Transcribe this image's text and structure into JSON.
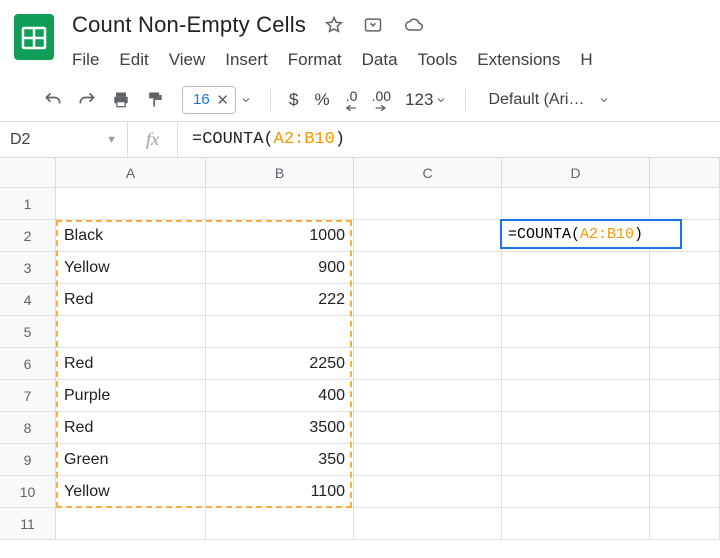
{
  "doc": {
    "title": "Count Non-Empty Cells"
  },
  "menu": {
    "file": "File",
    "edit": "Edit",
    "view": "View",
    "insert": "Insert",
    "format": "Format",
    "data": "Data",
    "tools": "Tools",
    "extensions": "Extensions",
    "help": "H"
  },
  "toolbar": {
    "font_size": "16",
    "currency": "$",
    "percent": "%",
    "dec_dec": ".0",
    "inc_dec": ".00",
    "num_fmt": "123",
    "font_name": "Default (Ari…"
  },
  "formula_bar": {
    "cell_ref": "D2",
    "fx": "fx",
    "formula_prefix": "=COUNTA",
    "formula_open": "(",
    "formula_range": "A2:B10",
    "formula_close": ")"
  },
  "columns": {
    "A": "A",
    "B": "B",
    "C": "C",
    "D": "D"
  },
  "rows": [
    "1",
    "2",
    "3",
    "4",
    "5",
    "6",
    "7",
    "8",
    "9",
    "10",
    "11"
  ],
  "cells": {
    "A2": "Black",
    "B2": "1000",
    "A3": "Yellow",
    "B3": "900",
    "A4": "Red",
    "B4": "222",
    "A6": "Red",
    "B6": "2250",
    "A7": "Purple",
    "B7": "400",
    "A8": "Red",
    "B8": "3500",
    "A9": "Green",
    "B9": "350",
    "A10": "Yellow",
    "B10": "1100"
  },
  "active": {
    "prefix": "=COUNTA",
    "open": "(",
    "range": "A2:B10",
    "close": ")"
  }
}
